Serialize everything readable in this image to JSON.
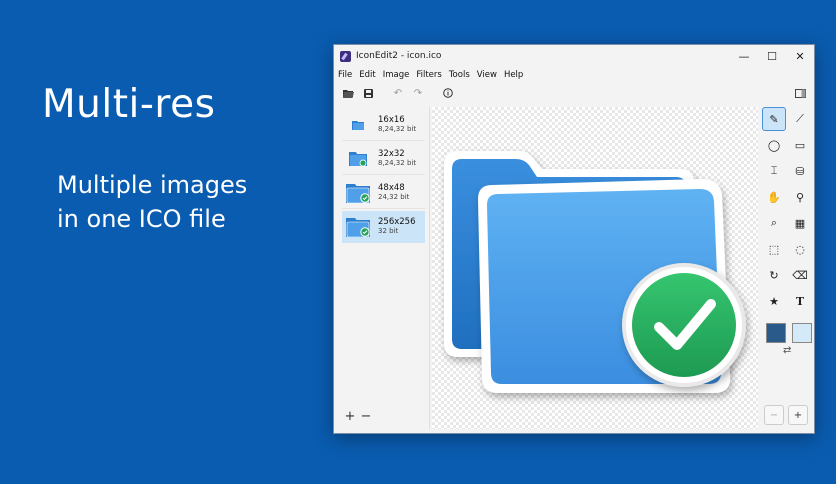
{
  "promo": {
    "title": "Multi-res",
    "subtitle_line1": "Multiple images",
    "subtitle_line2": "in one ICO file"
  },
  "window": {
    "title": "IconEdit2 - icon.ico",
    "controls": {
      "minimize": "—",
      "maximize": "☐",
      "close": "✕"
    }
  },
  "menu": [
    "File",
    "Edit",
    "Image",
    "Filters",
    "Tools",
    "View",
    "Help"
  ],
  "toolbar": {
    "open": "open-folder-icon",
    "save": "save-icon",
    "undo": "undo-icon",
    "redo": "redo-icon",
    "info": "info-icon",
    "panel_toggle": "panel-icon"
  },
  "images": [
    {
      "name": "16x16",
      "bits": "8,24,32 bit",
      "selected": false
    },
    {
      "name": "32x32",
      "bits": "8,24,32 bit",
      "selected": false
    },
    {
      "name": "48x48",
      "bits": "24,32 bit",
      "selected": false
    },
    {
      "name": "256x256",
      "bits": "32 bit",
      "selected": true
    }
  ],
  "image_actions": {
    "add": "+",
    "remove": "−"
  },
  "tools": [
    {
      "name": "pencil-icon",
      "glyph": "✎",
      "active": true
    },
    {
      "name": "line-icon",
      "glyph": "⟋",
      "active": false
    },
    {
      "name": "ellipse-icon",
      "glyph": "◯",
      "active": false
    },
    {
      "name": "rectangle-icon",
      "glyph": "▭",
      "active": false
    },
    {
      "name": "text-cursor-icon",
      "glyph": "⌶",
      "active": false
    },
    {
      "name": "fill-bucket-icon",
      "glyph": "⛁",
      "active": false
    },
    {
      "name": "hand-icon",
      "glyph": "✋",
      "active": false
    },
    {
      "name": "color-picker-icon",
      "glyph": "⚲",
      "active": false
    },
    {
      "name": "zoom-icon",
      "glyph": "⌕",
      "active": false
    },
    {
      "name": "replace-color-icon",
      "glyph": "▦",
      "active": false
    },
    {
      "name": "rect-select-icon",
      "glyph": "⬚",
      "active": false
    },
    {
      "name": "lasso-icon",
      "glyph": "◌",
      "active": false
    },
    {
      "name": "rotate-icon",
      "glyph": "↻",
      "active": false
    },
    {
      "name": "eraser-icon",
      "glyph": "⌫",
      "active": false
    },
    {
      "name": "star-icon",
      "glyph": "★",
      "active": false
    },
    {
      "name": "text-icon",
      "glyph": "T",
      "active": false
    }
  ],
  "colors": {
    "primary": "#2a5a8a",
    "secondary": "#d4eaf8",
    "background": "#0a5cb0"
  },
  "swap_glyph": "⇄",
  "zoom": {
    "out": "−",
    "in": "+"
  }
}
